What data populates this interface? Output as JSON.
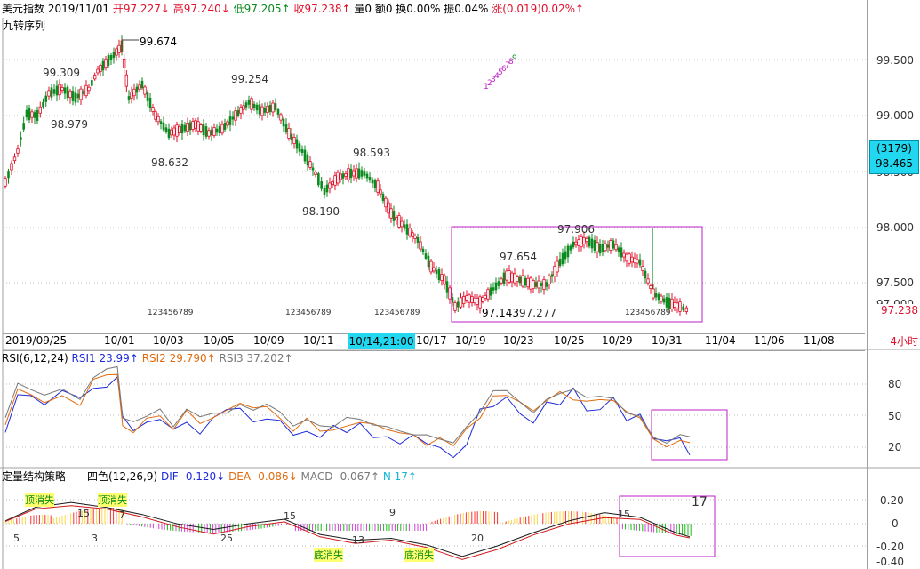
{
  "header": {
    "symbol": "美元指数",
    "date": "2019/11/01",
    "open": "开97.227↓",
    "high": "高97.240↓",
    "low": "低97.205↑",
    "close": "收97.238↑",
    "volume": "量0",
    "amount": "额0",
    "turnover": "换0.00%",
    "amplitude": "振0.04%",
    "change": "涨(0.019)0.02%↑",
    "indicator": "九转序列"
  },
  "price_axis": [
    "99.500",
    "99.000",
    "98.500",
    "98.000",
    "97.500",
    "97.000"
  ],
  "price_tag": {
    "count": "(3179)",
    "value": "98.465"
  },
  "last_price": "97.238",
  "annotations": {
    "highs": [
      "99.674",
      "99.309",
      "99.254",
      "98.593",
      "97.906",
      "97.654"
    ],
    "lows": [
      "98.979",
      "98.632",
      "98.190",
      "97.143",
      "97.277"
    ],
    "seq": "123456789"
  },
  "date_axis": [
    "2019/09/25",
    "10/01",
    "10/03",
    "10/05",
    "10/09",
    "10/11",
    "10/17",
    "10/19",
    "10/23",
    "10/25",
    "10/29",
    "10/31",
    "11/04",
    "11/06",
    "11/08"
  ],
  "cursor_date": "10/14,21:00",
  "period": "4小时",
  "rsi": {
    "title": "RSI(6,12,24)",
    "rsi1": "RSI1 23.99↑",
    "rsi2": "RSI2 29.790↑",
    "rsi3": "RSI3 37.202↑",
    "axis": [
      "80",
      "50",
      "20"
    ]
  },
  "macd": {
    "title": "定量结构策略——四色(12,26,9)",
    "dif": "DIF -0.120↓",
    "dea": "DEA -0.086↓",
    "macd": "MACD -0.067↑",
    "n": "N 17↑",
    "axis": [
      "0.20",
      "0",
      "-0.20",
      "-0.40"
    ],
    "labels": {
      "top_lost1": "顶消失",
      "top_lost2": "顶消失",
      "bottom_lost1": "底消失",
      "bottom_lost2": "底消失",
      "n5": "5",
      "n3": "3",
      "n15a": "15",
      "n7": "7",
      "n15b": "15",
      "n25": "25",
      "n9": "9",
      "n13": "13",
      "n20": "20",
      "n15c": "15",
      "n17": "17"
    }
  },
  "colors": {
    "up": "#e0102b",
    "down": "#0b8a1e",
    "rsi1": "#1d2ad8",
    "rsi2": "#e06c10",
    "rsi3": "#777777",
    "box": "#c020c8",
    "accent": "#22d8f0"
  }
}
